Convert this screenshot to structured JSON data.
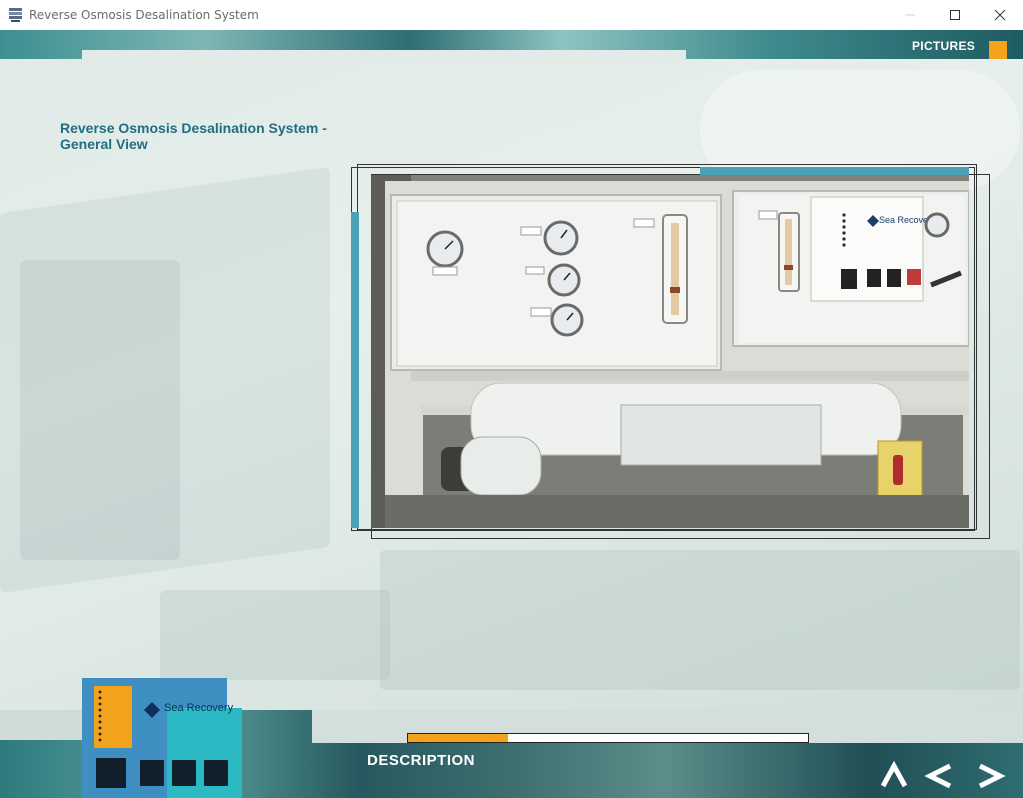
{
  "window": {
    "title": "Reverse Osmosis Desalination System"
  },
  "header": {
    "section_label": "PICTURES",
    "accent_color": "#f3a21c"
  },
  "content": {
    "heading": "Reverse Osmosis Desalination System - General View"
  },
  "photo": {
    "panel_brand": "Sea Recovery"
  },
  "footer": {
    "description_label": "DESCRIPTION",
    "progress_fraction": 0.25,
    "thumbnail_brand": "Sea Recovery",
    "nav_icons": [
      "up-icon",
      "back-icon",
      "forward-icon"
    ]
  }
}
